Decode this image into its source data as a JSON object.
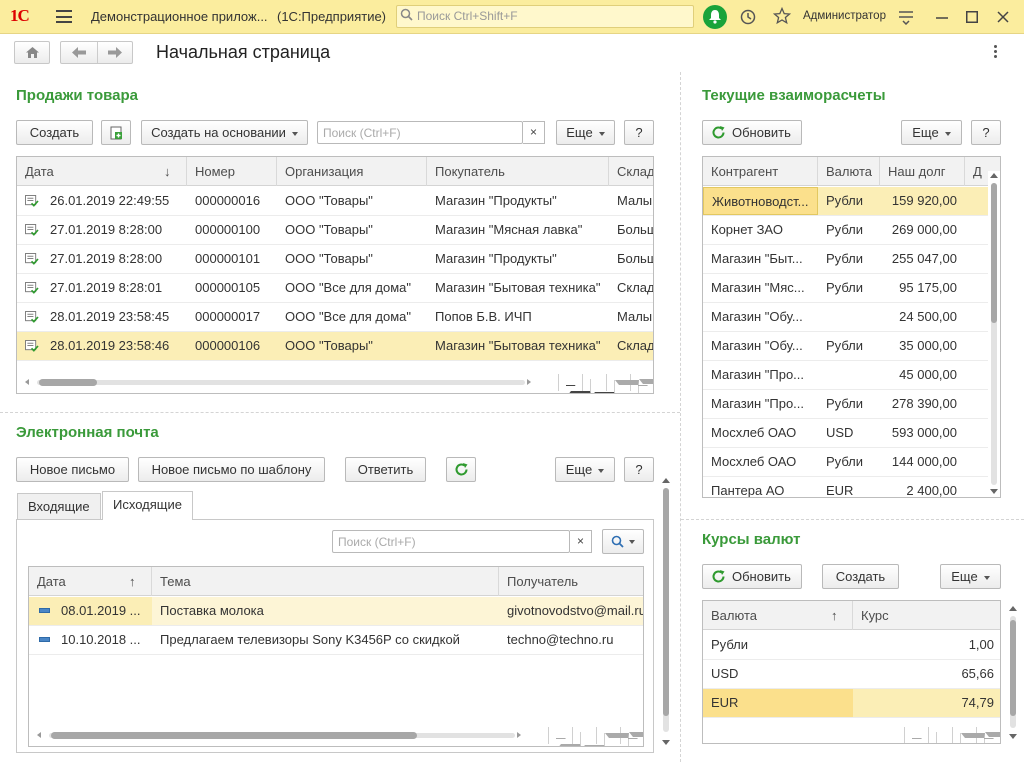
{
  "app": {
    "title": "Демонстрационное прилож...",
    "platform": "(1С:Предприятие)",
    "search_placeholder": "Поиск Ctrl+Shift+F",
    "user": "Администратор",
    "logo": "1С"
  },
  "nav": {
    "page_title": "Начальная страница"
  },
  "sales": {
    "title": "Продажи товара",
    "create": "Создать",
    "create_based": "Создать на основании",
    "search_placeholder": "Поиск (Ctrl+F)",
    "clear": "×",
    "more": "Еще",
    "help": "?",
    "columns": [
      "Дата",
      "Номер",
      "Организация",
      "Покупатель",
      "Склад"
    ],
    "sort_indicator": "↓",
    "rows": [
      {
        "date": "26.01.2019 22:49:55",
        "number": "000000016",
        "org": "ООО \"Товары\"",
        "buyer": "Магазин \"Продукты\"",
        "store": "Малый"
      },
      {
        "date": "27.01.2019 8:28:00",
        "number": "000000100",
        "org": "ООО \"Товары\"",
        "buyer": "Магазин \"Мясная лавка\"",
        "store": "Больш"
      },
      {
        "date": "27.01.2019 8:28:00",
        "number": "000000101",
        "org": "ООО \"Товары\"",
        "buyer": "Магазин \"Продукты\"",
        "store": "Больш"
      },
      {
        "date": "27.01.2019 8:28:01",
        "number": "000000105",
        "org": "ООО \"Все для дома\"",
        "buyer": "Магазин \"Бытовая техника\"",
        "store": "Склад"
      },
      {
        "date": "28.01.2019 23:58:45",
        "number": "000000017",
        "org": "ООО \"Все для дома\"",
        "buyer": "Попов Б.В. ИЧП",
        "store": "Малый"
      },
      {
        "date": "28.01.2019 23:58:46",
        "number": "000000106",
        "org": "ООО \"Товары\"",
        "buyer": "Магазин \"Бытовая техника\"",
        "store": "Склад"
      }
    ]
  },
  "mail": {
    "title": "Электронная почта",
    "new_letter": "Новое письмо",
    "new_from_template": "Новое письмо по шаблону",
    "reply": "Ответить",
    "more": "Еще",
    "help": "?",
    "tabs": [
      "Входящие",
      "Исходящие"
    ],
    "search_placeholder": "Поиск (Ctrl+F)",
    "clear": "×",
    "columns": [
      "Дата",
      "Тема",
      "Получатель"
    ],
    "sort_indicator": "↑",
    "rows": [
      {
        "date": "08.01.2019 ...",
        "subject": "Поставка молока",
        "recipient": "givotnovodstvo@mail.ru"
      },
      {
        "date": "10.10.2018 ...",
        "subject": "Предлагаем телевизоры Sony K3456P со скидкой",
        "recipient": "techno@techno.ru"
      }
    ]
  },
  "settlements": {
    "title": "Текущие взаиморасчеты",
    "refresh": "Обновить",
    "more": "Еще",
    "help": "?",
    "columns": [
      "Контрагент",
      "Валюта",
      "Наш долг",
      "Д"
    ],
    "rows": [
      {
        "party": "Животноводст...",
        "currency": "Рубли",
        "debt": "159 920,00"
      },
      {
        "party": "Корнет ЗАО",
        "currency": "Рубли",
        "debt": "269 000,00"
      },
      {
        "party": "Магазин \"Быт...",
        "currency": "Рубли",
        "debt": "255 047,00"
      },
      {
        "party": "Магазин \"Мяс...",
        "currency": "Рубли",
        "debt": "95 175,00"
      },
      {
        "party": "Магазин \"Обу...",
        "currency": "",
        "debt": "24 500,00"
      },
      {
        "party": "Магазин \"Обу...",
        "currency": "Рубли",
        "debt": "35 000,00"
      },
      {
        "party": "Магазин \"Про...",
        "currency": "",
        "debt": "45 000,00"
      },
      {
        "party": "Магазин \"Про...",
        "currency": "Рубли",
        "debt": "278 390,00"
      },
      {
        "party": "Мосхлеб ОАО",
        "currency": "USD",
        "debt": "593 000,00"
      },
      {
        "party": "Мосхлеб ОАО",
        "currency": "Рубли",
        "debt": "144 000,00"
      },
      {
        "party": "Пантера АО",
        "currency": "EUR",
        "debt": "2 400,00"
      }
    ]
  },
  "rates": {
    "title": "Курсы валют",
    "refresh": "Обновить",
    "create": "Создать",
    "more": "Еще",
    "columns": [
      "Валюта",
      "Курс"
    ],
    "sort_indicator": "↑",
    "rows": [
      {
        "currency": "Рубли",
        "rate": "1,00"
      },
      {
        "currency": "USD",
        "rate": "65,66"
      },
      {
        "currency": "EUR",
        "rate": "74,79"
      }
    ]
  },
  "colors": {
    "accent_green": "#3a9a3a",
    "titlebar": "#fbed9e",
    "selected_row": "#fbeeb6"
  }
}
